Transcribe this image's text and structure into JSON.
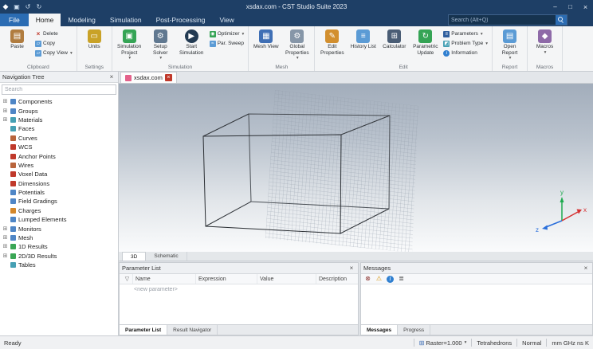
{
  "colors": {
    "titlebar": "#1e3f66",
    "file_tab": "#2b6cb3",
    "selected_tab_bg": "#f4f5f6",
    "axis_x": "#d63031",
    "axis_y": "#1faa4f",
    "axis_z": "#2a6fdb",
    "close_tab": "#c0392b"
  },
  "titlebar": {
    "title": "xsdax.com - CST Studio Suite 2023",
    "minimize": "–",
    "maximize": "□",
    "close": "×"
  },
  "menubar": {
    "file": "File",
    "tabs": [
      "Home",
      "Modeling",
      "Simulation",
      "Post-Processing",
      "View"
    ],
    "selected_tab": "Home",
    "search_placeholder": "Search (Alt+Q)"
  },
  "ribbon": {
    "clipboard": {
      "label": "Clipboard",
      "paste": "Paste",
      "delete": "Delete",
      "copy": "Copy",
      "copy_view": "Copy View"
    },
    "settings": {
      "label": "Settings",
      "units": "Units"
    },
    "simulation": {
      "label": "Simulation",
      "simulation_project": "Simulation Project",
      "setup_solver": "Setup Solver",
      "start_simulation": "Start Simulation",
      "optimizer": "Optimizer",
      "par_sweep": "Par. Sweep"
    },
    "mesh": {
      "label": "Mesh",
      "mesh_view": "Mesh View",
      "global_properties": "Global Properties"
    },
    "edit": {
      "label": "Edit",
      "edit_properties": "Edit Properties",
      "history_list": "History List",
      "calculator": "Calculator",
      "parametric_update": "Parametric Update",
      "parameters": "Parameters",
      "problem_type": "Problem Type",
      "information": "Information"
    },
    "report": {
      "label": "Report",
      "open_report": "Open Report"
    },
    "macros": {
      "label": "Macros",
      "macros": "Macros"
    }
  },
  "navigation_tree": {
    "title": "Navigation Tree",
    "search_placeholder": "Search",
    "items": [
      {
        "label": "Components",
        "color": "#4f86c6",
        "exp": "⊞"
      },
      {
        "label": "Groups",
        "color": "#4f86c6",
        "exp": "⊞"
      },
      {
        "label": "Materials",
        "color": "#46a0b4",
        "exp": "⊞"
      },
      {
        "label": "Faces",
        "color": "#46a0b4",
        "exp": ""
      },
      {
        "label": "Curves",
        "color": "#b8643c",
        "exp": ""
      },
      {
        "label": "WCS",
        "color": "#c0392b",
        "exp": ""
      },
      {
        "label": "Anchor Points",
        "color": "#c0392b",
        "exp": ""
      },
      {
        "label": "Wires",
        "color": "#b8643c",
        "exp": ""
      },
      {
        "label": "Voxel Data",
        "color": "#c0392b",
        "exp": ""
      },
      {
        "label": "Dimensions",
        "color": "#c0392b",
        "exp": ""
      },
      {
        "label": "Potentials",
        "color": "#4f86c6",
        "exp": ""
      },
      {
        "label": "Field Gradings",
        "color": "#4f86c6",
        "exp": ""
      },
      {
        "label": "Charges",
        "color": "#d4872a",
        "exp": ""
      },
      {
        "label": "Lumped Elements",
        "color": "#4f86c6",
        "exp": ""
      },
      {
        "label": "Monitors",
        "color": "#4f86c6",
        "exp": "⊞"
      },
      {
        "label": "Mesh",
        "color": "#4f86c6",
        "exp": "⊞"
      },
      {
        "label": "1D Results",
        "color": "#3aa655",
        "exp": "⊞"
      },
      {
        "label": "2D/3D Results",
        "color": "#3aa655",
        "exp": "⊞"
      },
      {
        "label": "Tables",
        "color": "#46a0b4",
        "exp": ""
      }
    ]
  },
  "document": {
    "tab_label": "xsdax.com"
  },
  "viewport": {
    "axis_x": "x",
    "axis_y": "y",
    "axis_z": "z",
    "tab_3d": "3D",
    "tab_schematic": "Schematic"
  },
  "parameter_list": {
    "title": "Parameter List",
    "columns": [
      "Name",
      "Expression",
      "Value",
      "Description"
    ],
    "placeholder_row": "<new parameter>",
    "tab_parameter_list": "Parameter List",
    "tab_result_navigator": "Result Navigator"
  },
  "messages": {
    "title": "Messages",
    "tab_messages": "Messages",
    "tab_progress": "Progress"
  },
  "statusbar": {
    "ready": "Ready",
    "tools": [
      "⊞",
      "⊕",
      "⊖",
      "↺",
      "↻",
      "⊙",
      "◎",
      "▣"
    ],
    "grid_icon": "⊞",
    "raster": "Raster=1.000",
    "mesh_type": "Tetrahedrons",
    "mode": "Normal",
    "units": "mm GHz ns K"
  },
  "icons": {
    "app_logo": "◆",
    "save": "▣",
    "undo": "↺",
    "redo": "↻",
    "paste": "▤",
    "delete": "×",
    "copy": "▱",
    "copy_view": "▱",
    "units": "▭",
    "simulation_project": "▣",
    "setup_solver": "⚙",
    "start_simulation": "▶",
    "optimizer": "◉",
    "par_sweep": "≈",
    "mesh_view": "▦",
    "global_properties": "⚙",
    "edit_properties": "✎",
    "history_list": "≡",
    "calculator": "⊞",
    "parametric_update": "↻",
    "parameters": "≡",
    "problem_type": "◩",
    "information": "i",
    "open_report": "▤",
    "macros": "◆",
    "dropdown": "▾",
    "filter": "▽",
    "msg_clear": "⊗",
    "msg_warning": "⚠",
    "msg_info": "i",
    "msg_columns": "≣",
    "close": "×"
  }
}
